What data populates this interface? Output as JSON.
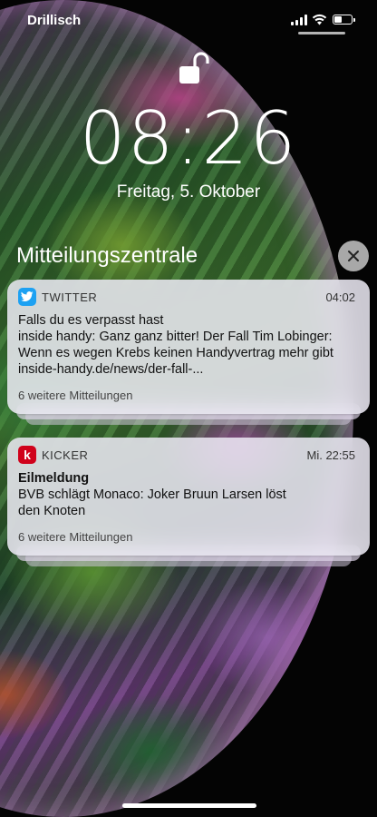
{
  "status_bar": {
    "carrier": "Drillisch",
    "battery_level": 0.45,
    "icons": [
      "signal-icon",
      "wifi-icon",
      "battery-icon"
    ]
  },
  "lock_screen": {
    "lock_icon": "unlocked-padlock-icon",
    "time": "08:26",
    "date": "Freitag, 5. Oktober"
  },
  "notification_center": {
    "title": "Mitteilungszentrale",
    "close_icon": "close-icon",
    "notifications": [
      {
        "app": "TWITTER",
        "icon": "twitter-bird-icon",
        "icon_color": "#1DA1F2",
        "time": "04:02",
        "title": "",
        "lines": [
          "Falls du es verpasst hast",
          "inside handy: Ganz ganz bitter! Der Fall Tim Lobinger:",
          "Wenn es wegen Krebs keinen Handyvertrag mehr gibt",
          "inside-handy.de/news/der-fall-..."
        ],
        "more": "6 weitere Mitteilungen"
      },
      {
        "app": "KICKER",
        "icon": "kicker-k-icon",
        "icon_color": "#D0021B",
        "time": "Mi. 22:55",
        "title": "Eilmeldung",
        "lines": [
          "BVB schlägt Monaco: Joker Bruun Larsen löst",
          "den Knoten"
        ],
        "more": "6 weitere Mitteilungen"
      }
    ]
  }
}
